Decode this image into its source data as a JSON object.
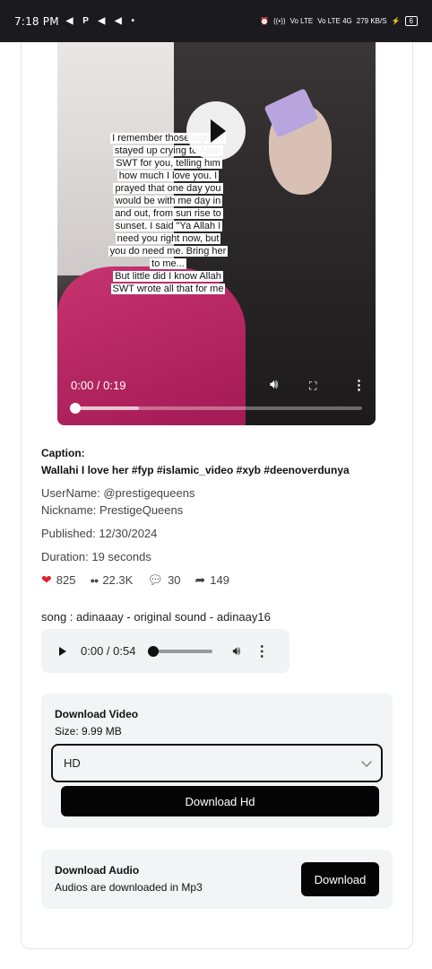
{
  "status_bar": {
    "time": "7:18 PM",
    "left_icons": "◀ P ◀ ◀ •",
    "right_icons": [
      "⏰",
      "((•))",
      "Vo LTE",
      "Vo LTE 4G",
      "279 KB/S",
      "⚡"
    ],
    "battery": "6"
  },
  "video": {
    "overlay_lines": [
      "I remember those nights I",
      "stayed up crying to Allah",
      "SWT for you, telling him",
      "how much I love you. I",
      "prayed that one day you",
      "would be with me day in",
      "and out, from sun rise to",
      "sunset. I said \"Ya Allah I",
      "need you right now, but",
      "you do need me. Bring her",
      "to me...",
      "But little did I know Allah",
      "SWT wrote all that for me"
    ],
    "time": "0:00 / 0:19",
    "progress": 0
  },
  "details": {
    "caption_label": "Caption:",
    "caption": "Wallahi I love her #fyp #islamic_video #xyb #deenoverdunya",
    "username": "UserName: @prestigequeens",
    "nickname": "Nickname: PrestigeQueens",
    "published": "Published: 12/30/2024",
    "duration": "Duration: 19 seconds"
  },
  "stats": {
    "likes": "825",
    "views": "22.3K",
    "comments": "30",
    "shares": "149"
  },
  "song": {
    "label": "song : adinaaay - original sound - adinaay16",
    "time": "0:00 / 0:54"
  },
  "download_video": {
    "title": "Download Video",
    "size": "Size: 9.99 MB",
    "quality_selected": "HD",
    "button_label": "Download Hd"
  },
  "download_audio": {
    "title": "Download Audio",
    "note": "Audios are downloaded in Mp3",
    "button_label": "Download"
  },
  "colors": {
    "heart": "#e0232c",
    "button_bg": "#050505",
    "panel_bg": "#f3f4f6"
  }
}
